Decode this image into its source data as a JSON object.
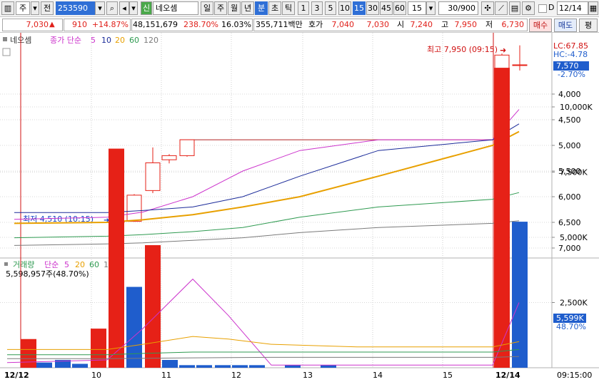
{
  "toolbar": {
    "market": "주",
    "period_btn": "전",
    "code": "253590",
    "credit_badge": "신",
    "stock_name": "네오셈",
    "periods": [
      "일",
      "주",
      "월",
      "년",
      "분",
      "초",
      "틱"
    ],
    "selected_period": "분",
    "intervals": [
      "1",
      "3",
      "5",
      "10",
      "15",
      "30",
      "45",
      "60"
    ],
    "selected_interval": "15",
    "interval_value": "15",
    "count": "30/900",
    "date": "12/14",
    "d_label": "D"
  },
  "info": {
    "price": "7,030",
    "change": "910",
    "change_pct": "+14.87%",
    "volume": "48,151,679",
    "vol_ratio": "238.70%",
    "turnover": "16.03%",
    "trade_amount": "355,711백만",
    "quote_label": "호가",
    "quote1": "7,040",
    "quote2": "7,030",
    "open_label": "시",
    "open": "7,240",
    "high_label": "고",
    "high": "7,950",
    "low_label": "저",
    "low": "6,730",
    "buy_button": "매수",
    "sell_button": "매도",
    "eval_button": "평"
  },
  "price_panel": {
    "stock_label": "네오셈",
    "ma_label": "종가 단순",
    "ma_periods": [
      "5",
      "10",
      "20",
      "60",
      "120"
    ],
    "lc": "LC:67.85",
    "hc": "HC:-4.78",
    "current_price": "7,570",
    "current_pct": "-2.70%",
    "max_annotation": "최고 7,950 (09:15)",
    "min_annotation": "최저 4,510 (10:15)",
    "y_labels": [
      "7,000",
      "6,500",
      "6,000",
      "5,500",
      "5,000",
      "4,500",
      "4,000"
    ]
  },
  "volume_panel": {
    "label": "거래량",
    "ma_label": "단순",
    "ma_periods": [
      "5",
      "20",
      "60",
      "120"
    ],
    "summary": "5,598,957주(48.70%)",
    "current_volume": "5,599K",
    "current_pct": "48.70%",
    "y_labels": [
      "10,000K",
      "7,500K",
      "5,000K",
      "2,500K"
    ]
  },
  "x_axis": {
    "labels": [
      "12/12",
      "10",
      "11",
      "12",
      "13",
      "14",
      "15",
      "12/14"
    ],
    "time": "09:15:00"
  },
  "colors": {
    "up": "#e62117",
    "down": "#1f5dcc",
    "ma5": "#cc33cc",
    "ma10": "#1a2a99",
    "ma20": "#e8a000",
    "ma60": "#2e9a50",
    "ma120": "#7a7a7a"
  },
  "chart_data": [
    {
      "type": "candlestick",
      "x": [
        "12/12 09:00",
        "12/12 10:00",
        "12/12 11:00",
        "12/12 12:00",
        "12/12 13:00",
        "12/12 14:00",
        "12/12 15:00",
        "12/14 09:00",
        "12/14 09:15"
      ],
      "candles": [
        {
          "o": 4510,
          "h": 4520,
          "l": 4510,
          "c": 4520
        },
        {
          "o": 4520,
          "h": 5050,
          "l": 4510,
          "c": 5030
        },
        {
          "o": 5120,
          "h": 5960,
          "l": 5070,
          "c": 5660
        },
        {
          "o": 5720,
          "h": 5830,
          "l": 5650,
          "c": 5800
        },
        {
          "o": 5800,
          "h": 6110,
          "l": 5780,
          "c": 6110
        },
        {
          "o": 6110,
          "h": 6110,
          "l": 6110,
          "c": 6110
        },
        {
          "o": 6110,
          "h": 6110,
          "l": 6110,
          "c": 6110
        },
        {
          "o": 7240,
          "h": 7790,
          "l": 6980,
          "c": 7760
        },
        {
          "o": 7570,
          "h": 7950,
          "l": 7460,
          "c": 7570
        }
      ],
      "series": [
        {
          "name": "5",
          "values": [
            4560,
            4600,
            4700,
            5000,
            5500,
            5900,
            6110,
            6110,
            6700
          ]
        },
        {
          "name": "10",
          "values": [
            4690,
            4690,
            4730,
            4800,
            5000,
            5400,
            5900,
            6110,
            6420
          ]
        },
        {
          "name": "20",
          "values": [
            4480,
            4500,
            4550,
            4650,
            4800,
            5000,
            5400,
            6000,
            6270
          ]
        },
        {
          "name": "60",
          "values": [
            4200,
            4230,
            4260,
            4320,
            4400,
            4600,
            4800,
            4950,
            5080
          ]
        },
        {
          "name": "120",
          "values": [
            4050,
            4080,
            4100,
            4150,
            4200,
            4300,
            4400,
            4480,
            4530
          ]
        }
      ],
      "ylim": [
        3850,
        8000
      ],
      "y_ticks": [
        4000,
        4500,
        5000,
        5500,
        6000,
        6500,
        7000
      ]
    },
    {
      "type": "bar",
      "series": [
        {
          "name": "거래량",
          "values": [
            1100,
            200,
            300,
            150,
            1500,
            8400,
            3100,
            4700,
            300,
            100,
            100,
            100,
            100,
            100,
            100,
            100,
            11500,
            5599
          ]
        }
      ],
      "ylim": [
        0,
        12500
      ],
      "y_ticks": [
        2500,
        5000,
        7500,
        10000
      ]
    }
  ]
}
